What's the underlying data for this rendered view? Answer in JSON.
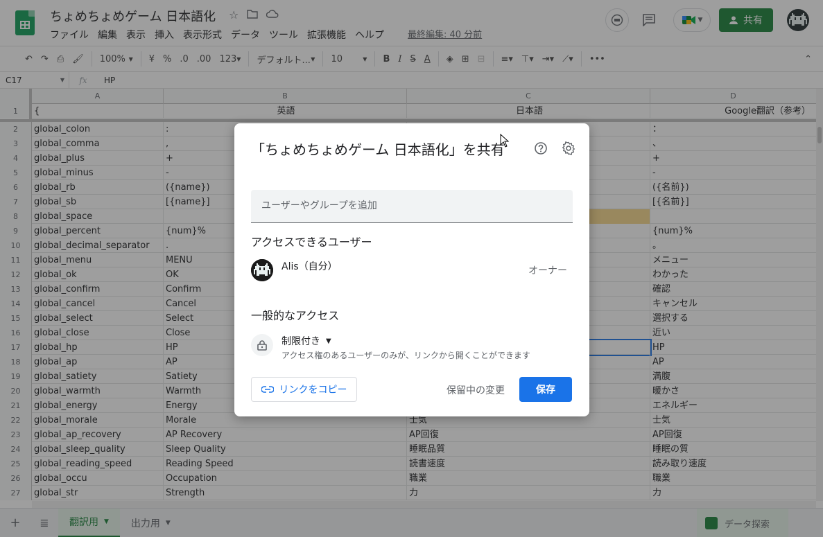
{
  "app": {
    "doc_title": "ちょめちょめゲーム 日本語化",
    "menu": [
      "ファイル",
      "編集",
      "表示",
      "挿入",
      "表示形式",
      "データ",
      "ツール",
      "拡張機能",
      "ヘルプ"
    ],
    "last_edit": "最終編集: 40 分前",
    "share_label": "共有"
  },
  "toolbar": {
    "zoom": "100%",
    "currency": "¥",
    "percent": "%",
    "dec_less": ".0",
    "dec_more": ".00",
    "num_format": "123",
    "font": "デフォルト...",
    "font_size": "10",
    "bold": "B",
    "italic": "I",
    "strike": "S",
    "text_color": "A"
  },
  "formula": {
    "cell_ref": "C17",
    "fx": "fx",
    "value": "HP"
  },
  "columns": [
    "A",
    "B",
    "C",
    "D"
  ],
  "rows": [
    {
      "n": "1",
      "a": "{",
      "b": "英語",
      "c": "日本語",
      "d": "Google翻訳（参考）"
    },
    {
      "n": "2",
      "a": "global_colon",
      "b": ":",
      "c": "",
      "d": "："
    },
    {
      "n": "3",
      "a": "global_comma",
      "b": ",",
      "c": "",
      "d": "、"
    },
    {
      "n": "4",
      "a": "global_plus",
      "b": "+",
      "c": "",
      "d": "+"
    },
    {
      "n": "5",
      "a": "global_minus",
      "b": "-",
      "c": "",
      "d": "-"
    },
    {
      "n": "6",
      "a": "global_rb",
      "b": " ({name})",
      "c": "",
      "d": " ({名前})"
    },
    {
      "n": "7",
      "a": "global_sb",
      "b": " [{name}]",
      "c": "",
      "d": " [{名前}]"
    },
    {
      "n": "8",
      "a": "global_space",
      "b": "",
      "c": "",
      "d": ""
    },
    {
      "n": "9",
      "a": "global_percent",
      "b": "{num}%",
      "c": "",
      "d": "{num}%"
    },
    {
      "n": "10",
      "a": "global_decimal_separator",
      "b": ".",
      "c": "",
      "d": "。"
    },
    {
      "n": "11",
      "a": "global_menu",
      "b": "MENU",
      "c": "",
      "d": "メニュー"
    },
    {
      "n": "12",
      "a": "global_ok",
      "b": "OK",
      "c": "",
      "d": "わかった"
    },
    {
      "n": "13",
      "a": "global_confirm",
      "b": "Confirm",
      "c": "",
      "d": "確認"
    },
    {
      "n": "14",
      "a": "global_cancel",
      "b": "Cancel",
      "c": "",
      "d": "キャンセル"
    },
    {
      "n": "15",
      "a": "global_select",
      "b": "Select",
      "c": "",
      "d": "選択する"
    },
    {
      "n": "16",
      "a": "global_close",
      "b": "Close",
      "c": "",
      "d": "近い"
    },
    {
      "n": "17",
      "a": "global_hp",
      "b": "HP",
      "c": "",
      "d": "HP"
    },
    {
      "n": "18",
      "a": "global_ap",
      "b": "AP",
      "c": "",
      "d": "AP"
    },
    {
      "n": "19",
      "a": "global_satiety",
      "b": "Satiety",
      "c": "",
      "d": "満腹"
    },
    {
      "n": "20",
      "a": "global_warmth",
      "b": "Warmth",
      "c": "",
      "d": "暖かさ"
    },
    {
      "n": "21",
      "a": "global_energy",
      "b": "Energy",
      "c": "",
      "d": "エネルギー"
    },
    {
      "n": "22",
      "a": "global_morale",
      "b": "Morale",
      "c": "士気",
      "d": "士気"
    },
    {
      "n": "23",
      "a": "global_ap_recovery",
      "b": "AP Recovery",
      "c": "AP回復",
      "d": "AP回復"
    },
    {
      "n": "24",
      "a": "global_sleep_quality",
      "b": "Sleep Quality",
      "c": "睡眠品質",
      "d": "睡眠の質"
    },
    {
      "n": "25",
      "a": "global_reading_speed",
      "b": "Reading Speed",
      "c": "読書速度",
      "d": "読み取り速度"
    },
    {
      "n": "26",
      "a": "global_occu",
      "b": "Occupation",
      "c": "職業",
      "d": "職業"
    },
    {
      "n": "27",
      "a": "global_str",
      "b": "Strength",
      "c": "力",
      "d": "力"
    }
  ],
  "sheets": [
    {
      "label": "翻訳用",
      "active": true
    },
    {
      "label": "出力用",
      "active": false
    }
  ],
  "explore_label": "データ探索",
  "dialog": {
    "title": "「ちょめちょめゲーム 日本語化」を共有",
    "add_placeholder": "ユーザーやグループを追加",
    "people_heading": "アクセスできるユーザー",
    "user_name": "Alis（自分）",
    "user_role": "オーナー",
    "general_heading": "一般的なアクセス",
    "access_level": "制限付き",
    "access_desc": "アクセス権のあるユーザーのみが、リンクから開くことができます",
    "copy_link": "リンクをコピー",
    "pending": "保留中の変更",
    "save": "保存"
  },
  "colors": {
    "brand_green": "#188038",
    "accent_blue": "#1a73e8"
  }
}
